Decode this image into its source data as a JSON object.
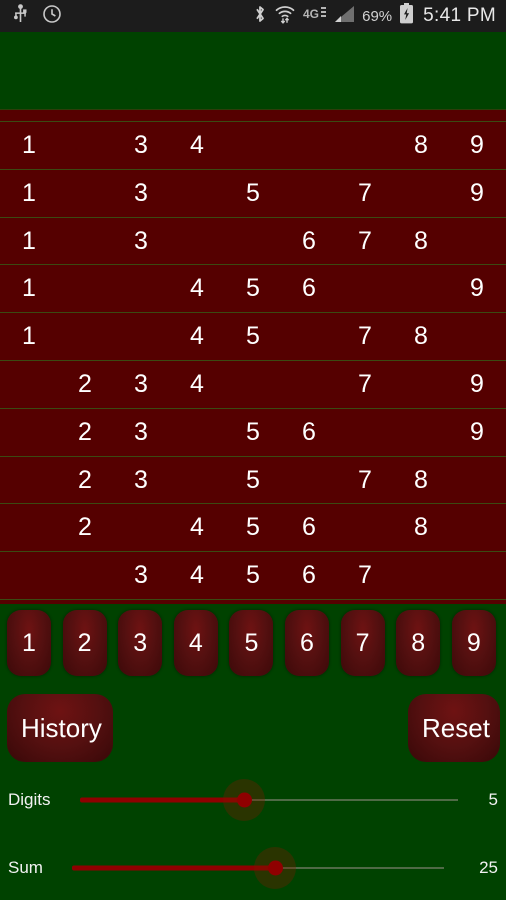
{
  "status_bar": {
    "icons_left": [
      "usb-icon",
      "clock-icon"
    ],
    "icons_right": [
      "bluetooth-icon",
      "wifi-icon",
      "lte-4g-icon",
      "cell-signal-icon",
      "battery-charging-icon"
    ],
    "network_label": "4G",
    "battery_percent": "69%",
    "time": "5:41 PM"
  },
  "colors": {
    "background_green": "#004200",
    "row_red": "#550000",
    "row_divider": "#3b4a12",
    "button_red": "#551010",
    "slider_fill": "#8f0000",
    "slider_track": "#4f6a46",
    "text_white": "#ffffff",
    "status_bar_bg": "#1c1c1c"
  },
  "grid": {
    "columns": [
      1,
      2,
      3,
      4,
      5,
      6,
      7,
      8,
      9
    ],
    "rows": [
      [
        "1",
        "",
        "3",
        "4",
        "",
        "",
        "",
        "8",
        "9"
      ],
      [
        "1",
        "",
        "3",
        "",
        "5",
        "",
        "7",
        "",
        "9"
      ],
      [
        "1",
        "",
        "3",
        "",
        "",
        "6",
        "7",
        "8",
        ""
      ],
      [
        "1",
        "",
        "",
        "4",
        "5",
        "6",
        "",
        "",
        "9"
      ],
      [
        "1",
        "",
        "",
        "4",
        "5",
        "",
        "7",
        "8",
        ""
      ],
      [
        "",
        "2",
        "3",
        "4",
        "",
        "",
        "7",
        "",
        "9"
      ],
      [
        "",
        "2",
        "3",
        "",
        "5",
        "6",
        "",
        "",
        "9"
      ],
      [
        "",
        "2",
        "3",
        "",
        "5",
        "",
        "7",
        "8",
        ""
      ],
      [
        "",
        "2",
        "",
        "4",
        "5",
        "6",
        "",
        "8",
        ""
      ],
      [
        "",
        "",
        "3",
        "4",
        "5",
        "6",
        "7",
        "",
        ""
      ]
    ]
  },
  "number_buttons": [
    {
      "label": "1"
    },
    {
      "label": "2"
    },
    {
      "label": "3"
    },
    {
      "label": "4"
    },
    {
      "label": "5"
    },
    {
      "label": "6"
    },
    {
      "label": "7"
    },
    {
      "label": "8"
    },
    {
      "label": "9"
    }
  ],
  "actions": {
    "history_label": "History",
    "reset_label": "Reset"
  },
  "sliders": [
    {
      "name": "digits",
      "label": "Digits",
      "value": "5",
      "fill_ratio": 0.435
    },
    {
      "name": "sum",
      "label": "Sum",
      "value": "25",
      "fill_ratio": 0.545
    }
  ]
}
